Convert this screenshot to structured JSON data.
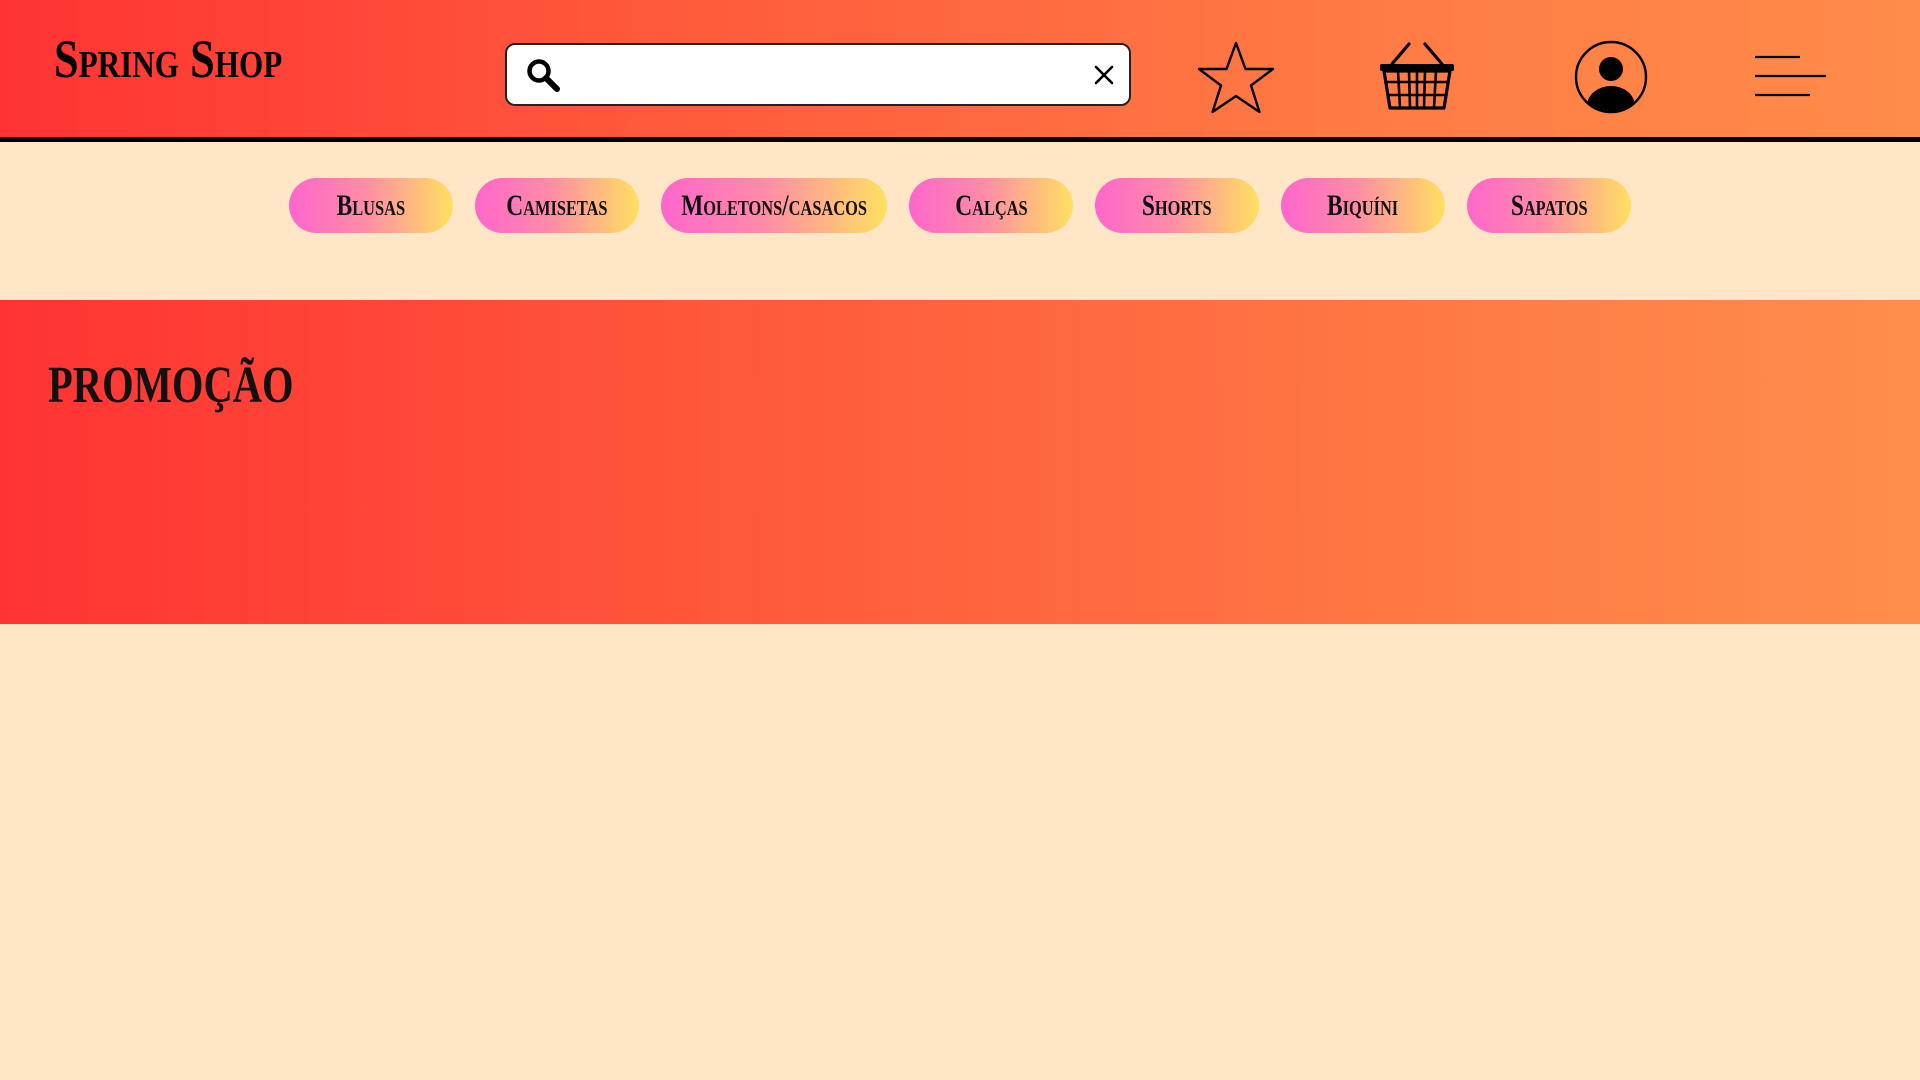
{
  "header": {
    "logo": "Spring Shop",
    "search": {
      "value": "",
      "placeholder": ""
    },
    "icons": [
      "search-icon",
      "close-icon",
      "star-icon",
      "basket-icon",
      "user-icon",
      "menu-icon"
    ]
  },
  "categories": [
    {
      "label": "Blusas"
    },
    {
      "label": "Camisetas"
    },
    {
      "label": "Moletons/casacos"
    },
    {
      "label": "Calças"
    },
    {
      "label": "Shorts"
    },
    {
      "label": "Biquíni"
    },
    {
      "label": "Sapatos"
    }
  ],
  "promo": {
    "title": "PROMOÇÃO"
  },
  "colors": {
    "background": "#ffe6c7",
    "header_gradient_start": "#ff3333",
    "header_gradient_end": "#ff8c4a",
    "pill_gradient_start": "#ff66cc",
    "pill_gradient_end": "#ffe060"
  }
}
